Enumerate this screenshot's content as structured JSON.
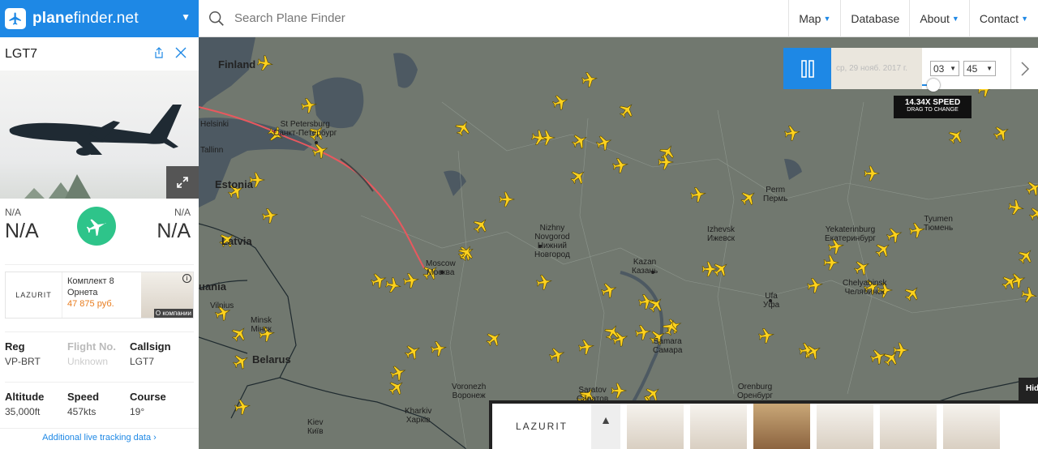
{
  "brand": {
    "name_bold": "plane",
    "name_rest": "finder.net"
  },
  "search": {
    "placeholder": "Search Plane Finder"
  },
  "nav": [
    {
      "label": "Map",
      "has_caret": true
    },
    {
      "label": "Database",
      "has_caret": false
    },
    {
      "label": "About",
      "has_caret": true
    },
    {
      "label": "Contact",
      "has_caret": true
    }
  ],
  "panel": {
    "callsign_title": "LGT7",
    "origin_code": "N/A",
    "origin_big": "N/A",
    "destination_code": "N/A",
    "destination_big": "N/A",
    "ad": {
      "brand": "LAZURIT",
      "title": "Комплект 8 Орнета",
      "price": "47 875 руб.",
      "company_label": "О компании",
      "info_icon": "i"
    },
    "details": {
      "reg_label": "Reg",
      "reg_value": "VP-BRT",
      "flight_label": "Flight No.",
      "flight_value": "Unknown",
      "callsign_label": "Callsign",
      "callsign_value": "LGT7",
      "altitude_label": "Altitude",
      "altitude_value": "35,000ft",
      "speed_label": "Speed",
      "speed_value": "457kts",
      "course_label": "Course",
      "course_value": "19°"
    },
    "more_link": "Additional live tracking data"
  },
  "playback": {
    "date": "ср, 29 нояб. 2017 г.",
    "hour": "03",
    "minute": "45",
    "speed": "14.34X SPEED",
    "speed_hint": "DRAG TO CHANGE"
  },
  "bottom_ad": {
    "brand": "LAZURIT",
    "hide_label": "Hid"
  },
  "map": {
    "countries": [
      {
        "id": "finland",
        "label": "Finland"
      },
      {
        "id": "estonia",
        "label": "Estonia"
      },
      {
        "id": "latvia",
        "label": "Latvia"
      },
      {
        "id": "lithuania",
        "label": "uania"
      },
      {
        "id": "belarus",
        "label": "Belarus"
      }
    ],
    "cities": [
      {
        "id": "helsinki",
        "label": "Helsinki"
      },
      {
        "id": "tallinn",
        "label": "Tallinn"
      },
      {
        "id": "stpetersburg",
        "label": "St Petersburg\nСанкт-Петербург"
      },
      {
        "id": "vilnius",
        "label": "Vilnius"
      },
      {
        "id": "minsk",
        "label": "Minsk\nМінск"
      },
      {
        "id": "moscow",
        "label": "Moscow\nМосква"
      },
      {
        "id": "nizhny",
        "label": "Nizhny\nNovgorod\nНижний\nНовгород"
      },
      {
        "id": "kazan",
        "label": "Kazan\nКазань"
      },
      {
        "id": "izhevsk",
        "label": "Izhevsk\nИжевск"
      },
      {
        "id": "perm",
        "label": "Perm\nПермь"
      },
      {
        "id": "yekaterinburg",
        "label": "Yekaterinburg\nЕкатеринбург"
      },
      {
        "id": "tyumen",
        "label": "Tyumen\nТюмень"
      },
      {
        "id": "chelyabinsk",
        "label": "Chelyabinsk\nЧелябинск"
      },
      {
        "id": "ufa",
        "label": "Ufa\nУфа"
      },
      {
        "id": "samara",
        "label": "Samara\nСамара"
      },
      {
        "id": "saratov",
        "label": "Saratov\nСаратов"
      },
      {
        "id": "voronezh",
        "label": "Voronezh\nВоронеж"
      },
      {
        "id": "orenburg",
        "label": "Orenburg\nОренбург"
      },
      {
        "id": "kharkiv",
        "label": "Kharkiv\nХарків"
      },
      {
        "id": "kiev",
        "label": "Kiev\nКиїв"
      }
    ]
  },
  "colors": {
    "brand_blue": "#1e88e5",
    "status_green": "#2ec48a",
    "plane_yellow": "#ffd21e",
    "track_red": "#e8585e",
    "ad_price_orange": "#e87c1e"
  }
}
